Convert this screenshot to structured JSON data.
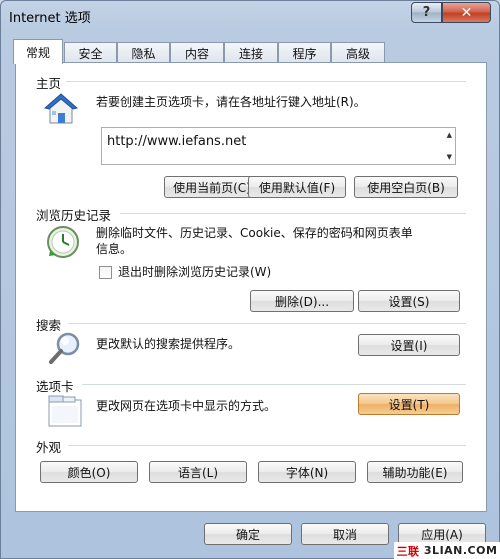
{
  "window": {
    "title": "Internet 选项",
    "help_glyph": "?",
    "close_glyph": "✕"
  },
  "tabs": [
    {
      "label": "常规",
      "active": true
    },
    {
      "label": "安全"
    },
    {
      "label": "隐私"
    },
    {
      "label": "内容"
    },
    {
      "label": "连接"
    },
    {
      "label": "程序"
    },
    {
      "label": "高级"
    }
  ],
  "homepage": {
    "title": "主页",
    "description": "若要创建主页选项卡，请在各地址行键入地址(R)。",
    "url": "http://www.iefans.net",
    "buttons": {
      "use_current": "使用当前页(C)",
      "use_default": "使用默认值(F)",
      "use_blank": "使用空白页(B)"
    }
  },
  "history": {
    "title": "浏览历史记录",
    "description_line1": "删除临时文件、历史记录、Cookie、保存的密码和网页表单",
    "description_line2": "信息。",
    "checkbox_label": "退出时删除浏览历史记录(W)",
    "checkbox_checked": false,
    "buttons": {
      "delete": "删除(D)...",
      "settings": "设置(S)"
    }
  },
  "search": {
    "title": "搜索",
    "description": "更改默认的搜索提供程序。",
    "settings_button": "设置(I)"
  },
  "tabs_section": {
    "title": "选项卡",
    "description": "更改网页在选项卡中显示的方式。",
    "settings_button": "设置(T)"
  },
  "appearance": {
    "title": "外观",
    "buttons": {
      "colors": "颜色(O)",
      "languages": "语言(L)",
      "fonts": "字体(N)",
      "accessibility": "辅助功能(E)"
    }
  },
  "dialog_buttons": {
    "ok": "确定",
    "cancel": "取消",
    "apply": "应用(A)"
  },
  "watermark": {
    "prefix": "三联",
    "suffix": "3LIAN.COM"
  }
}
